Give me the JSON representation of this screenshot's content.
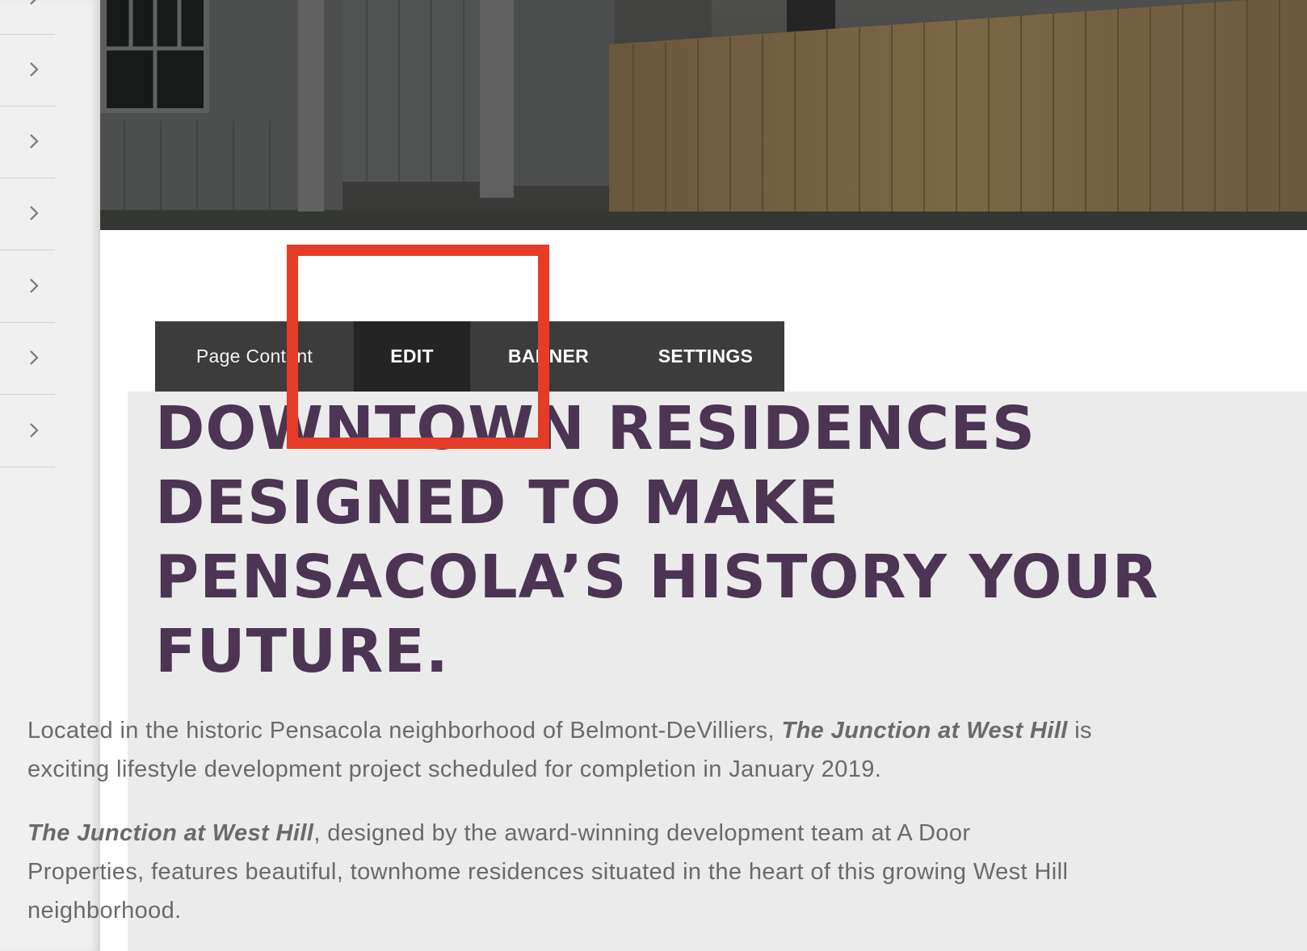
{
  "sidebar": {
    "rows": [
      {
        "icon": "chevron-right-icon"
      },
      {
        "icon": "chevron-right-icon"
      },
      {
        "icon": "chevron-right-icon"
      },
      {
        "icon": "chevron-right-icon"
      },
      {
        "icon": "chevron-right-icon"
      },
      {
        "icon": "chevron-right-icon"
      },
      {
        "icon": "chevron-right-icon"
      }
    ]
  },
  "toolbar": {
    "label": "Page Content",
    "edit": "EDIT",
    "banner": "BANNER",
    "settings": "SETTINGS"
  },
  "content": {
    "headline": "DOWNTOWN RESIDENCES DESIGNED TO MAKE PENSACOLA’S HISTORY YOUR FUTURE.",
    "para1_prefix": "Located in the historic Pensacola neighborhood of Belmont-DeVilliers, ",
    "para1_bold": "The Junction at West Hill",
    "para1_suffix_line1": " is",
    "para1_line2": "exciting lifestyle development project scheduled for completion in January 2019.",
    "para2_bold": "The Junction at West Hill",
    "para2_line1": ", designed by the award-winning development team at A Door",
    "para2_line2": "Properties, features beautiful,  townhome residences situated in the heart of this growing West Hill",
    "para2_line3": "neighborhood."
  },
  "colors": {
    "headline": "#4b3553",
    "toolbar_bg": "#3c3c3c",
    "toolbar_active": "#242424",
    "annotation": "#e63c26",
    "content_bg": "#ebebeb"
  }
}
